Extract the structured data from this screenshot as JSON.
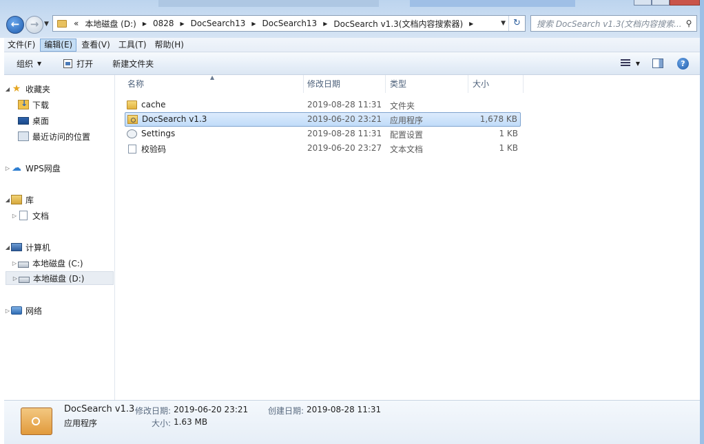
{
  "address": {
    "overflow": "«",
    "crumbs": [
      "本地磁盘 (D:)",
      "0828",
      "DocSearch13",
      "DocSearch13",
      "DocSearch v1.3(文档内容搜索器)"
    ]
  },
  "search": {
    "placeholder": "搜索 DocSearch v1.3(文档内容搜索..."
  },
  "menu": [
    "文件(F)",
    "编辑(E)",
    "查看(V)",
    "工具(T)",
    "帮助(H)"
  ],
  "commands": {
    "organize": "组织",
    "open": "打开",
    "new_folder": "新建文件夹"
  },
  "nav": {
    "favorites": "收藏夹",
    "downloads": "下载",
    "desktop": "桌面",
    "recent": "最近访问的位置",
    "wps": "WPS网盘",
    "libraries": "库",
    "documents": "文档",
    "computer": "计算机",
    "drive_c": "本地磁盘 (C:)",
    "drive_d": "本地磁盘 (D:)",
    "network": "网络"
  },
  "columns": {
    "name": "名称",
    "date": "修改日期",
    "type": "类型",
    "size": "大小"
  },
  "files": [
    {
      "name": "cache",
      "date": "2019-08-28 11:31",
      "type": "文件夹",
      "size": ""
    },
    {
      "name": "DocSearch v1.3",
      "date": "2019-06-20 23:21",
      "type": "应用程序",
      "size": "1,678 KB"
    },
    {
      "name": "Settings",
      "date": "2019-08-28 11:31",
      "type": "配置设置",
      "size": "1 KB"
    },
    {
      "name": "校验码",
      "date": "2019-06-20 23:27",
      "type": "文本文档",
      "size": "1 KB"
    }
  ],
  "details": {
    "name": "DocSearch v1.3",
    "type": "应用程序",
    "modified_label": "修改日期:",
    "modified": "2019-06-20 23:21",
    "created_label": "创建日期:",
    "created": "2019-08-28 11:31",
    "size_label": "大小:",
    "size": "1.63 MB"
  }
}
